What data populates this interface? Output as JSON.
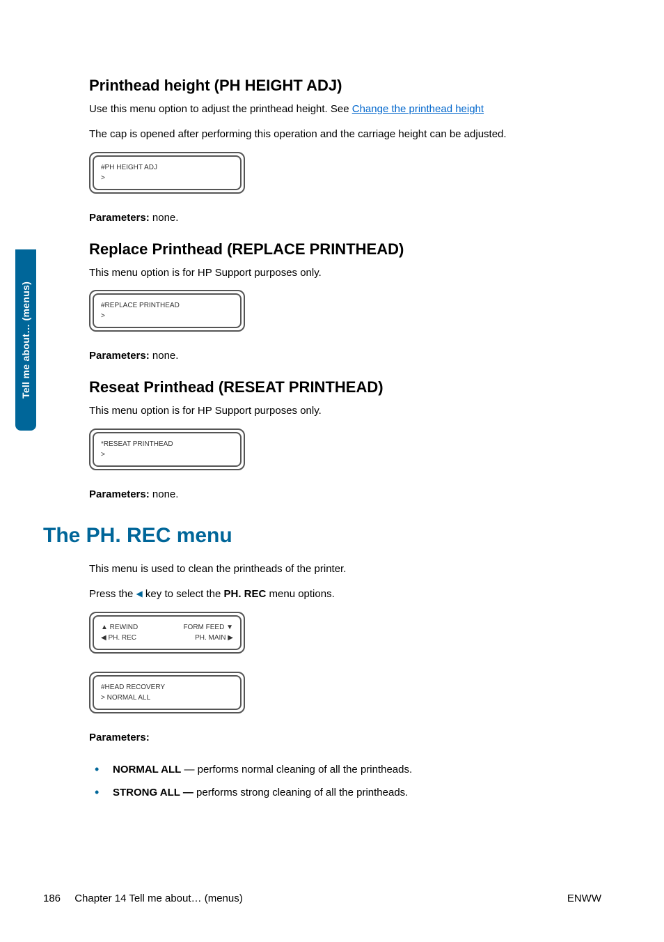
{
  "sidebar": {
    "label": "Tell me about… (menus)"
  },
  "section1": {
    "heading": "Printhead height (PH HEIGHT ADJ)",
    "p1_a": "Use this menu option to adjust the printhead height. See ",
    "p1_link": "Change the printhead height",
    "p2": "The cap is opened after performing this operation and the carriage height can be adjusted.",
    "lcd_l1": "#PH HEIGHT ADJ",
    "lcd_l2": ">",
    "params_label": "Parameters:",
    "params_val": " none."
  },
  "section2": {
    "heading": "Replace Printhead (REPLACE PRINTHEAD)",
    "p1": "This menu option is for HP Support purposes only.",
    "lcd_l1": "#REPLACE PRINTHEAD",
    "lcd_l2": ">",
    "params_label": "Parameters:",
    "params_val": " none."
  },
  "section3": {
    "heading": "Reseat Printhead (RESEAT PRINTHEAD)",
    "p1": "This menu option is for HP Support purposes only.",
    "lcd_l1": "*RESEAT PRINTHEAD",
    "lcd_l2": ">",
    "params_label": "Parameters:",
    "params_val": " none."
  },
  "section4": {
    "heading": "The PH. REC menu",
    "p1": "This menu is used to clean the printheads of the printer.",
    "p2_a": "Press the ",
    "p2_b": " key to select the ",
    "p2_bold": "PH. REC",
    "p2_c": " menu options.",
    "lcd1_tl": "▲ REWIND",
    "lcd1_tr": "FORM FEED ▼",
    "lcd1_bl": "◀ PH. REC",
    "lcd1_br": "PH. MAIN ▶",
    "lcd2_l1": "#HEAD RECOVERY",
    "lcd2_l2": "> NORMAL ALL",
    "params_label": "Parameters:",
    "bullets": [
      {
        "bold": "NORMAL ALL",
        "rest": " — performs normal cleaning of all the printheads."
      },
      {
        "bold": "STRONG ALL —",
        "rest": " performs strong cleaning of all the printheads."
      }
    ]
  },
  "footer": {
    "page": "186",
    "chapter": "Chapter 14   Tell me about… (menus)",
    "right": "ENWW"
  }
}
